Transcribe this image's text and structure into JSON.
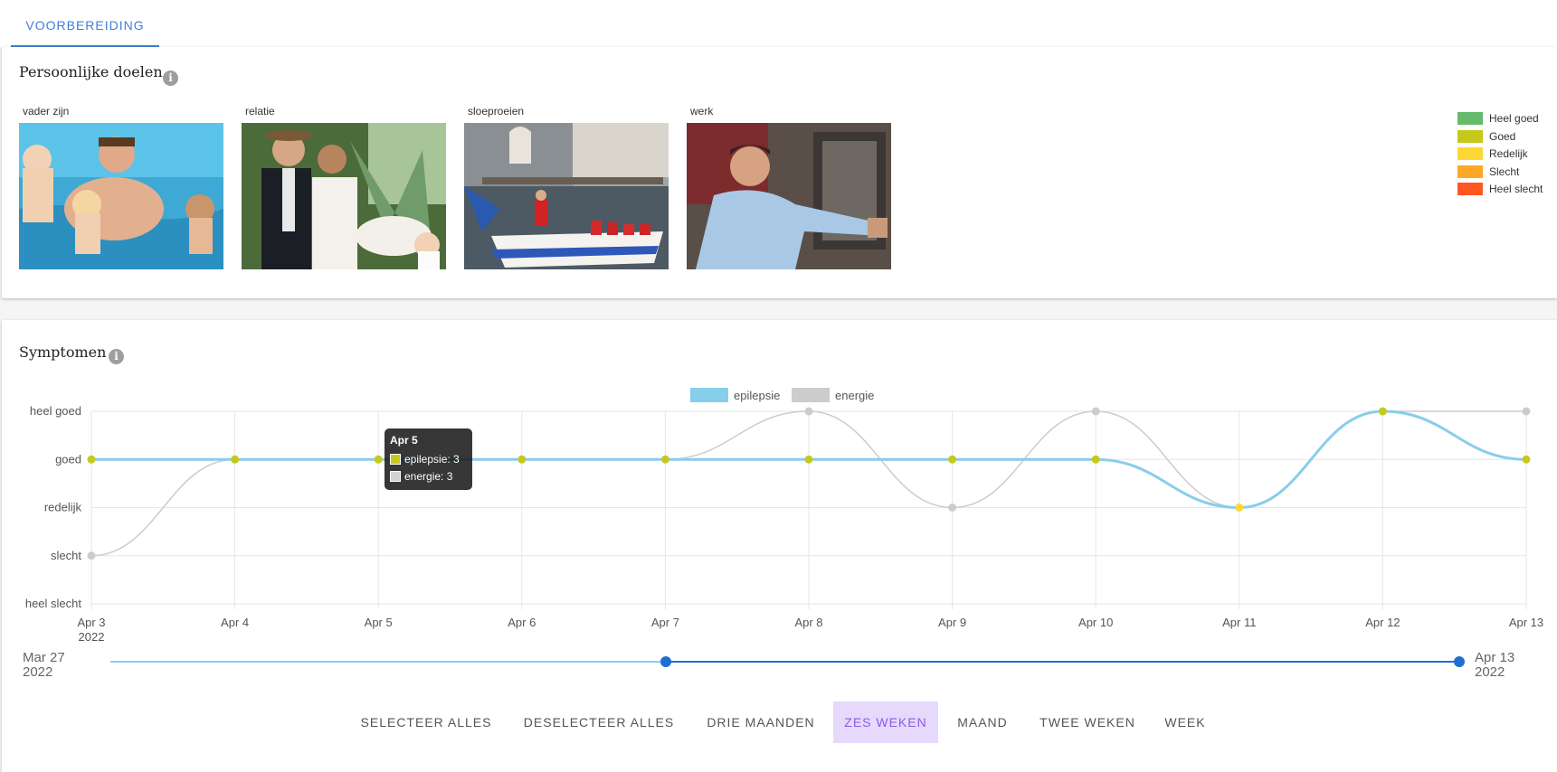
{
  "tabs": [
    {
      "label": "VOORBEREIDING"
    }
  ],
  "goals": {
    "title": "Persoonlijke doelen",
    "info_icon": "info-icon",
    "items": [
      {
        "label": "vader zijn"
      },
      {
        "label": "relatie"
      },
      {
        "label": "sloeproeien"
      },
      {
        "label": "werk"
      }
    ],
    "legend": [
      {
        "label": "Heel goed",
        "color": "#66bb6a"
      },
      {
        "label": "Goed",
        "color": "#c6c91c"
      },
      {
        "label": "Redelijk",
        "color": "#fdd835"
      },
      {
        "label": "Slecht",
        "color": "#ffa726"
      },
      {
        "label": "Heel slecht",
        "color": "#ff5722"
      }
    ]
  },
  "symptoms": {
    "title": "Symptomen",
    "info_icon": "info-icon",
    "tooltip": {
      "title": "Apr 5",
      "lines": [
        "epilepsie: 3",
        "energie: 3"
      ]
    },
    "range": {
      "start_line1": "Mar 27",
      "start_line2": "2022",
      "end_line1": "Apr 13",
      "end_line2": "2022"
    },
    "buttons": [
      {
        "label": "SELECTEER ALLES"
      },
      {
        "label": "DESELECTEER ALLES"
      },
      {
        "label": "DRIE MAANDEN"
      },
      {
        "label": "ZES WEKEN",
        "active": true
      },
      {
        "label": "MAAND"
      },
      {
        "label": "TWEE WEKEN"
      },
      {
        "label": "WEEK"
      }
    ]
  },
  "chart_data": {
    "type": "line",
    "categories": [
      "Apr 3",
      "Apr 4",
      "Apr 5",
      "Apr 6",
      "Apr 7",
      "Apr 8",
      "Apr 9",
      "Apr 10",
      "Apr 11",
      "Apr 12",
      "Apr 13"
    ],
    "first_category_year": "2022",
    "y_ticks": [
      "heel slecht",
      "slecht",
      "redelijk",
      "goed",
      "heel goed"
    ],
    "ylim": [
      0,
      4
    ],
    "grid": true,
    "legend_position": "top-center",
    "series": [
      {
        "name": "epilepsie",
        "color": "#87ceeb",
        "values": [
          3,
          3,
          3,
          3,
          3,
          3,
          3,
          3,
          2,
          4,
          3
        ]
      },
      {
        "name": "energie",
        "color": "#cccccc",
        "values": [
          1,
          3,
          3,
          3,
          3,
          4,
          2,
          4,
          2,
          4,
          4
        ]
      }
    ],
    "point_colors": {
      "4": "#c6c91c",
      "3": "#c6c91c",
      "2": "#fdd835",
      "1": "#cccccc"
    }
  }
}
